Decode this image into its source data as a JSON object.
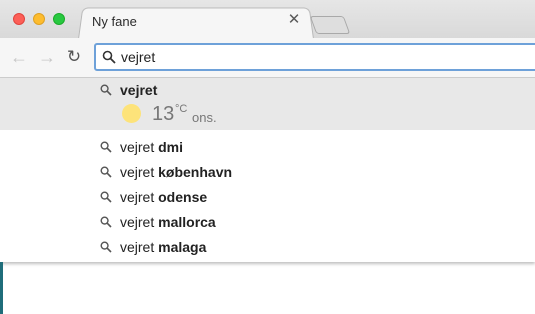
{
  "tab": {
    "title": "Ny fane"
  },
  "omnibox": {
    "value": "vejret"
  },
  "weather": {
    "temperature": "13",
    "unit": "°C",
    "day": "ons."
  },
  "suggestions": [
    {
      "prefix": "vejret",
      "suffix": ""
    },
    {
      "prefix": "vejret",
      "suffix": "dmi"
    },
    {
      "prefix": "vejret",
      "suffix": "københavn"
    },
    {
      "prefix": "vejret",
      "suffix": "odense"
    },
    {
      "prefix": "vejret",
      "suffix": "mallorca"
    },
    {
      "prefix": "vejret",
      "suffix": "malaga"
    }
  ],
  "colors": {
    "accent": "#6ea1d9",
    "close": "#fc5f57",
    "minimize": "#fdbc2e",
    "maximize": "#28c840",
    "sun": "#fde37a"
  }
}
